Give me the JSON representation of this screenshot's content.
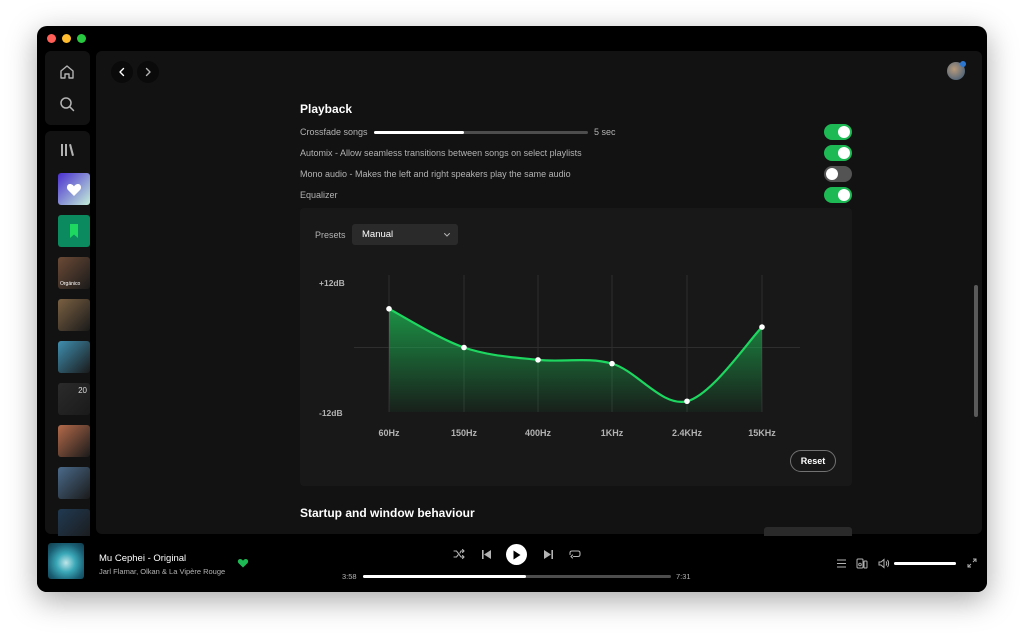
{
  "colors": {
    "accent": "#1db954",
    "background": "#000000",
    "panel": "#121212",
    "eq_box": "#181818"
  },
  "sidebar": {
    "nav": [
      {
        "name": "home-icon"
      },
      {
        "name": "search-icon"
      }
    ],
    "library_icon": "library-icon",
    "playlists": [
      {
        "label": "",
        "kind": "liked-songs",
        "color": "#7b5cf0"
      },
      {
        "label": "",
        "kind": "your-episodes",
        "color": "#0b8a5f"
      },
      {
        "label": "Orgánico",
        "kind": "cover",
        "color": "#6b4a36"
      },
      {
        "label": "",
        "kind": "cover",
        "color": "#7a6042"
      },
      {
        "label": "",
        "kind": "cover",
        "color": "#3f8fb0"
      },
      {
        "label": "20",
        "kind": "cover",
        "color": "#2b2b2b"
      },
      {
        "label": "",
        "kind": "cover",
        "color": "#b46a4a"
      },
      {
        "label": "",
        "kind": "cover",
        "color": "#4a6a8a"
      },
      {
        "label": "",
        "kind": "cover",
        "color": "#213a52"
      }
    ]
  },
  "settings": {
    "playback": {
      "title": "Playback",
      "crossfade_label": "Crossfade songs",
      "crossfade_value": "5 sec",
      "crossfade_fraction": 0.42,
      "rows": [
        {
          "label": "Crossfade songs",
          "on": true
        },
        {
          "label": "Automix - Allow seamless transitions between songs on select playlists",
          "on": true
        },
        {
          "label": "Mono audio - Makes the left and right speakers play the same audio",
          "on": false
        },
        {
          "label": "Equalizer",
          "on": true
        }
      ]
    },
    "equalizer": {
      "presets_label": "Presets",
      "preset_value": "Manual",
      "db_max": "+12dB",
      "db_min": "-12dB",
      "reset_label": "Reset",
      "bands": [
        {
          "label": "60Hz",
          "gain": 7.2
        },
        {
          "label": "150Hz",
          "gain": 0.0
        },
        {
          "label": "400Hz",
          "gain": -2.3
        },
        {
          "label": "1KHz",
          "gain": -3.0
        },
        {
          "label": "2.4KHz",
          "gain": -10.0
        },
        {
          "label": "15KHz",
          "gain": 3.8
        }
      ]
    },
    "startup": {
      "title": "Startup and window behaviour"
    }
  },
  "player": {
    "track_title": "Mu Cephei - Original",
    "artists": "Jarl Flamar, Olkan & La Vipère Rouge",
    "time_elapsed": "3:58",
    "time_total": "7:31",
    "progress_fraction": 0.53,
    "volume_fraction": 1.0,
    "liked": true
  }
}
